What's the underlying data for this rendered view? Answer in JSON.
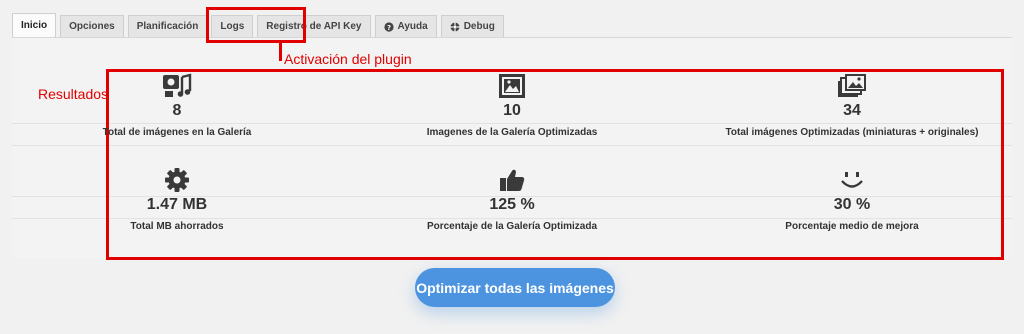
{
  "tabs": [
    {
      "label": "Inicio",
      "active": true,
      "icon": ""
    },
    {
      "label": "Opciones",
      "active": false,
      "icon": ""
    },
    {
      "label": "Planificación",
      "active": false,
      "icon": ""
    },
    {
      "label": "Logs",
      "active": false,
      "icon": ""
    },
    {
      "label": "Registro de API Key",
      "active": false,
      "icon": ""
    },
    {
      "label": "Ayuda",
      "active": false,
      "icon": "help-icon"
    },
    {
      "label": "Debug",
      "active": false,
      "icon": "debug-icon"
    }
  ],
  "annotations": {
    "activation": "Activación del plugin",
    "results": "Resultados",
    "color": "#e10000"
  },
  "stats": [
    {
      "icon": "image-music-icon",
      "value": "8",
      "label": "Total de imágenes en la Galería"
    },
    {
      "icon": "image-frame-icon",
      "value": "10",
      "label": "Imagenes de la Galería Optimizadas"
    },
    {
      "icon": "images-stack-icon",
      "value": "34",
      "label": "Total imágenes Optimizadas (miniaturas + originales)"
    },
    {
      "icon": "gear-icon",
      "value": "1.47 MB",
      "label": "Total MB ahorrados"
    },
    {
      "icon": "thumbs-up-icon",
      "value": "125 %",
      "label": "Porcentaje de la Galería Optimizada"
    },
    {
      "icon": "smile-icon",
      "value": "30 %",
      "label": "Porcentaje medio de mejora"
    }
  ],
  "button": {
    "label": "Optimizar todas las imágenes",
    "color": "#4d94e0"
  }
}
